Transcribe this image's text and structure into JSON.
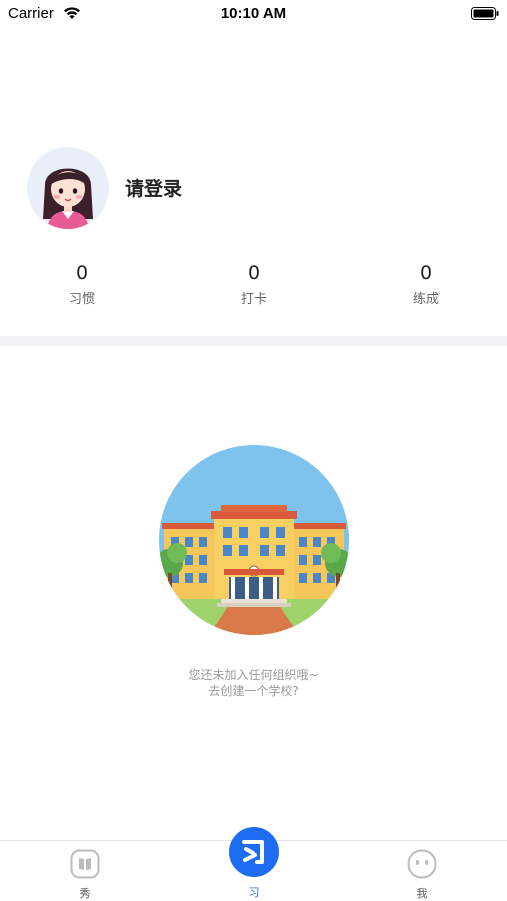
{
  "status_bar": {
    "carrier": "Carrier",
    "time": "10:10 AM"
  },
  "profile": {
    "login_prompt": "请登录"
  },
  "stats": [
    {
      "value": "0",
      "label": "习惯"
    },
    {
      "value": "0",
      "label": "打卡"
    },
    {
      "value": "0",
      "label": "练成"
    }
  ],
  "empty_state": {
    "line1": "您还未加入任何组织哦~",
    "line2": "去创建一个学校?"
  },
  "tab_bar": {
    "tabs": [
      {
        "label": "秀",
        "icon": "book-icon"
      },
      {
        "label": "习",
        "icon": "habit-logo-icon",
        "active": true
      },
      {
        "label": "我",
        "icon": "face-icon"
      }
    ],
    "center_glyph": "习"
  },
  "colors": {
    "accent": "#1e6cf2",
    "divider": "#f1f2f5",
    "muted_text": "#9a9a9a"
  }
}
